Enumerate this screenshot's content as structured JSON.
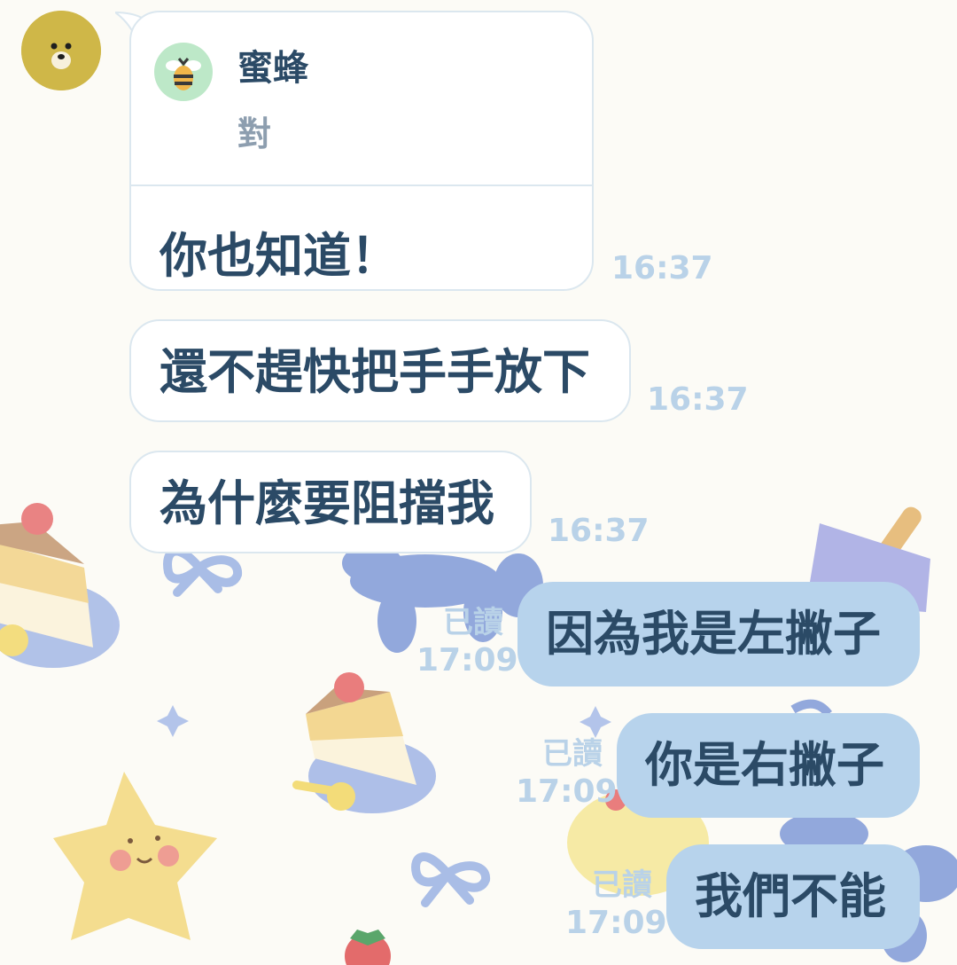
{
  "chat": {
    "reply_message": {
      "quoted_sender": "蜜蜂",
      "quoted_text": "對",
      "text": "你也知道！",
      "time": "16:37"
    },
    "incoming": [
      {
        "text": "還不趕快把手手放下",
        "time": "16:37"
      },
      {
        "text": "為什麼要阻擋我",
        "time": "16:37"
      }
    ],
    "outgoing": [
      {
        "text": "因為我是左撇子",
        "read": "已讀",
        "time": "17:09"
      },
      {
        "text": "你是右撇子",
        "read": "已讀",
        "time": "17:09"
      },
      {
        "text": "我們不能",
        "read": "已讀",
        "time": "17:09"
      }
    ]
  },
  "icons": {
    "avatar": "bear-avatar-icon",
    "quoted_sender_avatar": "bee-icon"
  },
  "colors": {
    "background": "#fcfbf6",
    "incoming_bubble": "#ffffff",
    "outgoing_bubble": "#b7d3ec",
    "message_text": "#2b4a66",
    "meta_text": "#b9d2e8"
  }
}
